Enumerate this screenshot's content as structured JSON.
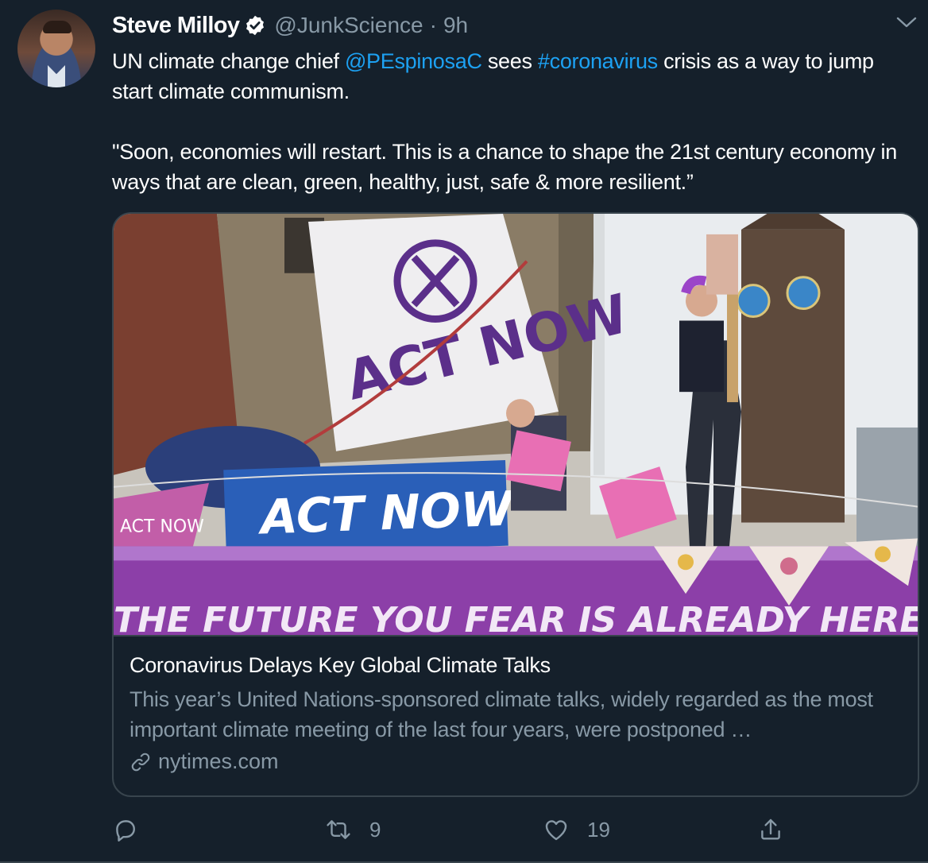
{
  "tweet": {
    "author_name": "Steve Milloy",
    "author_handle": "@JunkScience",
    "separator": "·",
    "timestamp": "9h",
    "text": {
      "p1_a": "UN climate change chief ",
      "mention": "@PEspinosaC",
      "p1_b": " sees ",
      "hashtag": "#coronavirus",
      "p1_c": " crisis as a way to jump start climate communism.",
      "p2": "\"Soon, economies will restart. This is a chance to shape the 21st century economy in ways that are clean, green, healthy, just, safe & more resilient.”"
    },
    "card": {
      "image_signs": {
        "banner_top": "ACT NOW",
        "banner_blue": "ACT NOW",
        "boat_text": "THE FUTURE YOU FEAR IS ALREADY HERE",
        "left_flag": "ACT NOW"
      },
      "title": "Coronavirus Delays Key Global Climate Talks",
      "description": "This year’s United Nations-sponsored climate talks, widely regarded as the most important climate meeting of the last four years, were postponed …",
      "domain": "nytimes.com"
    },
    "actions": {
      "reply_count": "",
      "retweet_count": "9",
      "like_count": "19"
    }
  },
  "icons": {
    "verified": "verified-badge-icon",
    "caret": "chevron-down-icon",
    "link": "link-icon",
    "reply": "reply-icon",
    "retweet": "retweet-icon",
    "like": "heart-icon",
    "share": "share-icon"
  },
  "colors": {
    "background": "#15202b",
    "link": "#1da1f2",
    "secondary_text": "#8899a6",
    "border": "#38444d"
  }
}
